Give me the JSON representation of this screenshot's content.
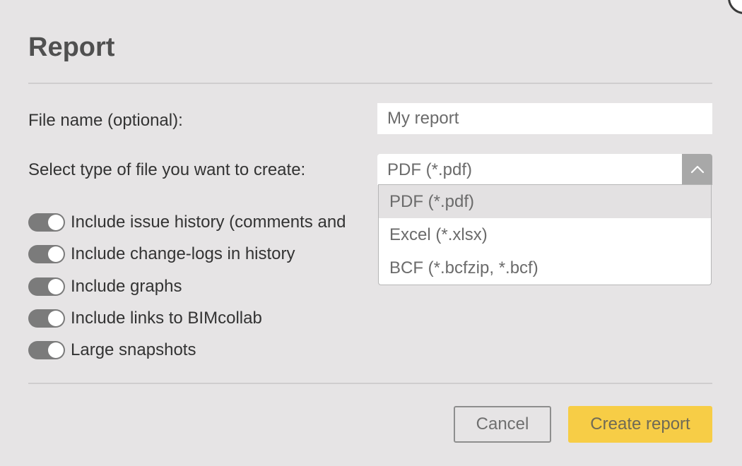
{
  "dialog": {
    "title": "Report"
  },
  "form": {
    "file_name_label": "File name (optional):",
    "file_name_value": "My report",
    "file_type_label": "Select type of file you want to create:",
    "file_type_selected": "PDF (*.pdf)",
    "file_type_options": [
      "PDF (*.pdf)",
      "Excel (*.xlsx)",
      "BCF (*.bcfzip, *.bcf)"
    ]
  },
  "toggles": [
    {
      "label": "Include issue history (comments and",
      "on": true
    },
    {
      "label": "Include change-logs in history",
      "on": true
    },
    {
      "label": "Include graphs",
      "on": true
    },
    {
      "label": "Include links to BIMcollab",
      "on": true
    },
    {
      "label": "Large snapshots",
      "on": true
    }
  ],
  "buttons": {
    "cancel_label": "Cancel",
    "create_label": "Create report"
  },
  "colors": {
    "background": "#e6e4e5",
    "accent": "#f7cd46",
    "toggle_on": "#7b7b7b"
  }
}
